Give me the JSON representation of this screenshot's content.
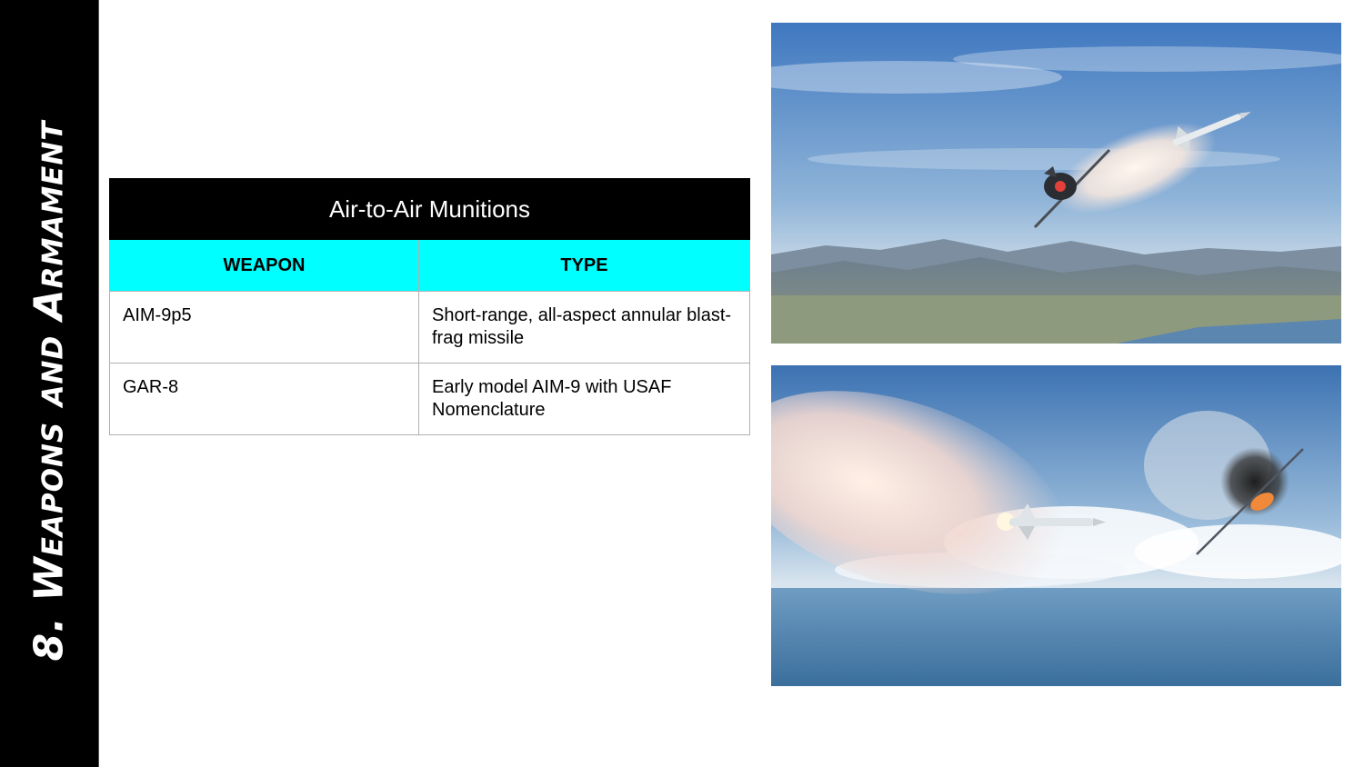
{
  "sidebar": {
    "title": "8. Weapons and Armament"
  },
  "table": {
    "title": "Air-to-Air Munitions",
    "headers": [
      "WEAPON",
      "TYPE"
    ],
    "rows": [
      {
        "weapon": "AIM-9p5",
        "type": "Short-range, all-aspect annular blast-frag missile"
      },
      {
        "weapon": "GAR-8",
        "type": "Early model AIM-9 with USAF Nomenclature"
      }
    ]
  },
  "colors": {
    "header_accent": "#00ffff",
    "title_bar": "#000000"
  }
}
